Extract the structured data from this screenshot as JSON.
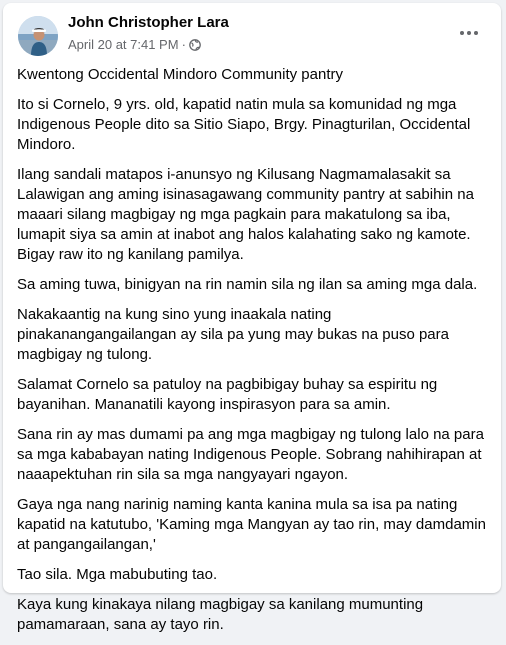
{
  "post": {
    "author": "John Christopher Lara",
    "date": "April 20 at 7:41 PM",
    "separator": "·",
    "privacy_icon": "globe-icon",
    "more_icon": "more-horizontal-icon",
    "paragraphs": [
      "Kwentong Occidental Mindoro Community pantry",
      "Ito si Cornelo, 9 yrs. old, kapatid natin mula sa komunidad ng mga Indigenous People dito sa Sitio Siapo, Brgy. Pinagturilan, Occidental Mindoro.",
      "Ilang sandali matapos i-anunsyo ng Kilusang Nagmamalasakit sa Lalawigan ang aming isinasagawang community pantry at sabihin na maaari silang magbigay ng mga pagkain para makatulong sa iba, lumapit siya sa amin at inabot ang halos kalahating sako ng kamote. Bigay raw ito ng kanilang pamilya.",
      "Sa aming tuwa, binigyan na rin namin sila ng ilan sa aming mga dala.",
      "Nakakaantig na kung sino yung inaakala nating pinakanangangailangan ay sila pa yung may bukas na puso para magbigay ng tulong.",
      "Salamat Cornelo sa patuloy na pagbibigay buhay sa espiritu ng bayanihan. Mananatili kayong inspirasyon para sa amin.",
      "Sana rin ay mas dumami pa ang mga magbigay ng tulong lalo na para sa mga kababayan nating Indigenous People. Sobrang nahihirapan at naaapektuhan rin sila sa mga nangyayari ngayon.",
      "Gaya nga nang narinig naming kanta kanina mula sa isa pa nating kapatid na katutubo, 'Kaming mga Mangyan ay tao rin, may damdamin at pangangailangan,'",
      "Tao sila. Mga mabubuting tao.",
      "Kaya kung kinakaya nilang magbigay sa kanilang mumunting pamamaraan, sana ay tayo rin."
    ]
  }
}
